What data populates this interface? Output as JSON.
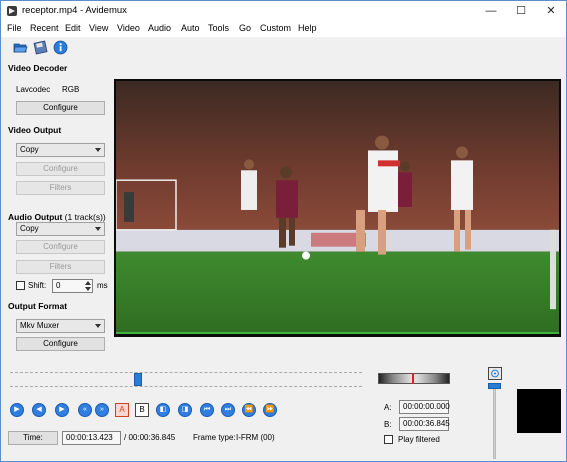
{
  "window": {
    "title": "receptor.mp4 - Avidemux",
    "minimize": "—",
    "maximize": "☐",
    "close": "✕"
  },
  "menu": [
    "File",
    "Recent",
    "Edit",
    "View",
    "Video",
    "Audio",
    "Auto",
    "Tools",
    "Go",
    "Custom",
    "Help"
  ],
  "toolbar": {
    "icons": [
      "open-folder-icon",
      "save-icon",
      "info-icon"
    ]
  },
  "video_decoder": {
    "heading": "Video Decoder",
    "codec": "Lavcodec",
    "colorspace": "RGB",
    "configure": "Configure"
  },
  "video_output": {
    "heading": "Video Output",
    "codec": "Copy",
    "configure": "Configure",
    "filters": "Filters"
  },
  "audio_output": {
    "heading": "Audio Output",
    "tracks": "(1 track(s))",
    "codec": "Copy",
    "configure": "Configure",
    "filters": "Filters",
    "shift_label": "Shift:",
    "shift_value": "0",
    "shift_unit": "ms"
  },
  "output_format": {
    "heading": "Output Format",
    "muxer": "Mkv Muxer",
    "configure": "Configure"
  },
  "player": {
    "time_button": "Time:",
    "current_time": "00:00:13.423",
    "total_time": "/ 00:00:36.845",
    "frame_type_label": "Frame type:",
    "frame_type": "I-FRM (00)",
    "position_fraction": 0.364
  },
  "markers": {
    "a_label": "A:",
    "a_value": "00:00:00.000",
    "b_label": "B:",
    "b_value": "00:00:36.845",
    "play_filtered": "Play filtered"
  },
  "nav_buttons": [
    "play",
    "previous-frame",
    "next-frame",
    "previous-keyframe",
    "next-keyframe",
    "set-marker-a",
    "set-marker-b",
    "previous-black",
    "next-black",
    "go-to-marker-a",
    "go-to-marker-b",
    "first-frame",
    "last-frame"
  ],
  "nav_glyphs": {
    "a": "A",
    "b": "B"
  }
}
